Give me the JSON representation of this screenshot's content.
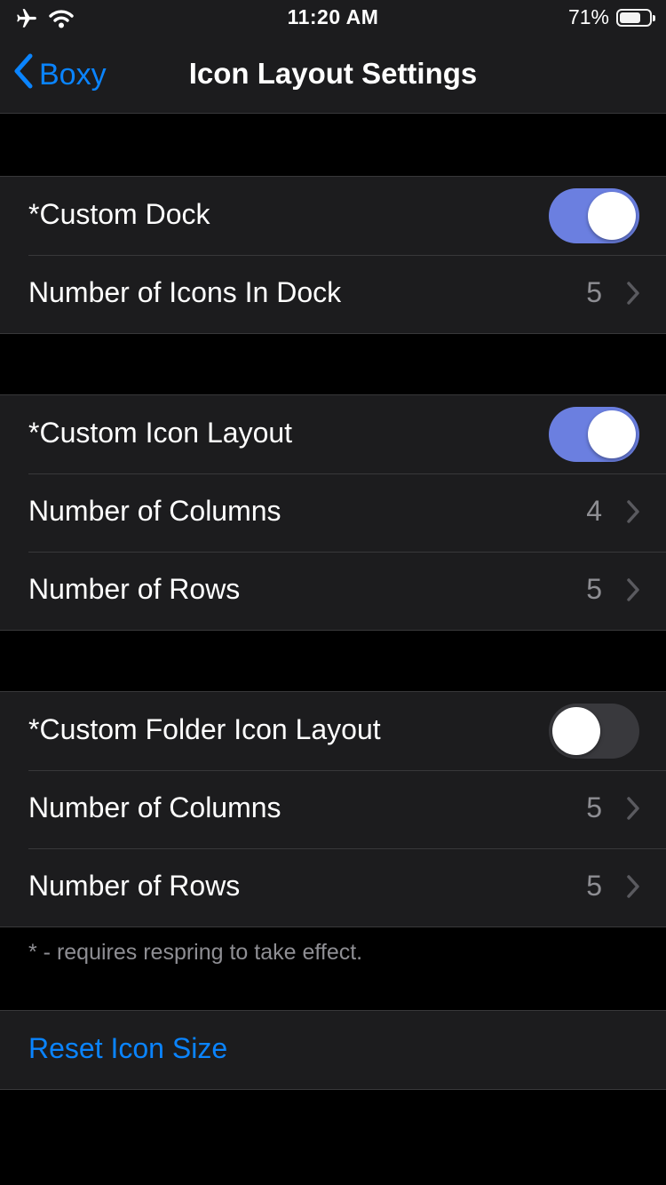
{
  "status_bar": {
    "time": "11:20 AM",
    "battery_percent": "71%",
    "battery_level": 0.71,
    "icons": [
      "airplane-icon",
      "wifi-icon",
      "battery-icon"
    ]
  },
  "nav": {
    "back_label": "Boxy",
    "title": "Icon Layout Settings"
  },
  "sections": {
    "dock": {
      "toggle_label": "*Custom Dock",
      "toggle_on": true,
      "icons_label": "Number of Icons In Dock",
      "icons_value": "5"
    },
    "icon_layout": {
      "toggle_label": "*Custom Icon Layout",
      "toggle_on": true,
      "columns_label": "Number of Columns",
      "columns_value": "4",
      "rows_label": "Number of Rows",
      "rows_value": "5"
    },
    "folder_layout": {
      "toggle_label": "*Custom Folder Icon Layout",
      "toggle_on": false,
      "columns_label": "Number of Columns",
      "columns_value": "5",
      "rows_label": "Number of Rows",
      "rows_value": "5"
    }
  },
  "footer_note": "* - requires respring to take effect.",
  "reset": {
    "label": "Reset Icon Size"
  },
  "colors": {
    "accent": "#0a84ff",
    "toggle_on": "#6b7fe0",
    "toggle_off": "#39393d",
    "cell_background": "#1c1c1e",
    "secondary_text": "#8e8e93"
  }
}
